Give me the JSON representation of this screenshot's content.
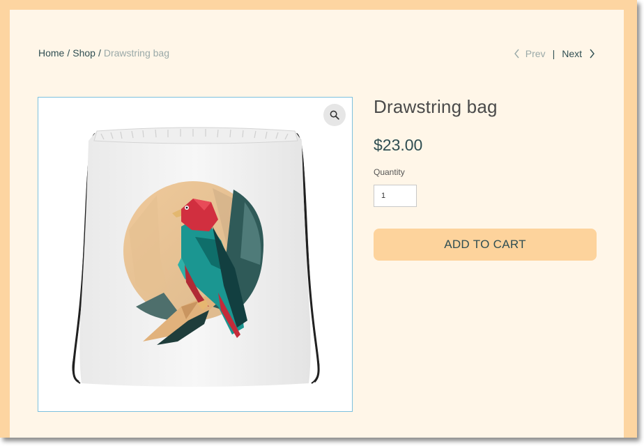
{
  "breadcrumb": {
    "home": "Home",
    "separator": "/",
    "shop": "Shop",
    "current": "Drawstring bag"
  },
  "pager": {
    "prev": "Prev",
    "divider": "|",
    "next": "Next"
  },
  "product": {
    "title": "Drawstring bag",
    "price": "$23.00",
    "quantity_label": "Quantity",
    "quantity_value": "1",
    "add_to_cart": "ADD TO CART",
    "zoom_icon": "magnifier-icon",
    "image_subject": "white drawstring bag with low-poly red and teal eagle perched on a branch"
  },
  "colors": {
    "page_bg": "#fff6e8",
    "frame": "#fdd5a1",
    "button_bg": "#fdd39c",
    "text_dark": "#2f4e52",
    "text_muted": "#9aa9a8",
    "image_border": "#7cc0de"
  }
}
